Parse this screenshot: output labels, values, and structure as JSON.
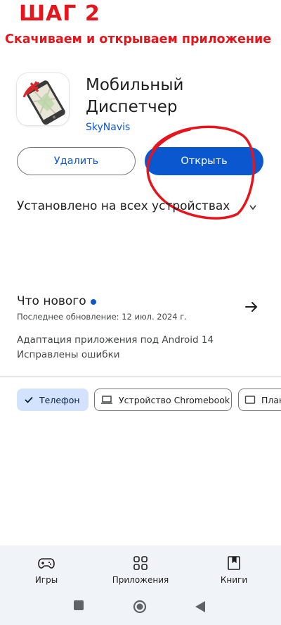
{
  "overlay": {
    "step_title": "ШАГ 2",
    "step_subtitle": "Скачиваем и открываем приложение",
    "annotation_color": "#e8141b"
  },
  "app": {
    "name_line1": "Мобильный",
    "name_line2": "Диспетчер",
    "developer": "SkyNavis",
    "icon": "phone-map-icon"
  },
  "actions": {
    "uninstall_label": "Удалить",
    "open_label": "Открыть"
  },
  "installed_status": "Установлено на всех устройствах",
  "whats_new": {
    "title": "Что нового",
    "last_updated": "Последнее обновление: 12 июл. 2024 г.",
    "notes": [
      "Адаптация приложения под Android 14",
      "Исправлены ошибки"
    ]
  },
  "device_chips": [
    {
      "label": "Телефон",
      "icon": "check-icon",
      "selected": true
    },
    {
      "label": "Устройство Chromebook",
      "icon": "laptop-icon",
      "selected": false
    },
    {
      "label": "Планшет",
      "icon": "tablet-icon",
      "selected": false
    }
  ],
  "bottom_nav": [
    {
      "label": "Игры",
      "icon": "gamepad-icon"
    },
    {
      "label": "Приложения",
      "icon": "apps-grid-icon"
    },
    {
      "label": "Книги",
      "icon": "book-icon"
    }
  ],
  "colors": {
    "accent": "#0b57d0",
    "selected_chip": "#d3e3fd",
    "nav_background": "#f0f4f9"
  }
}
